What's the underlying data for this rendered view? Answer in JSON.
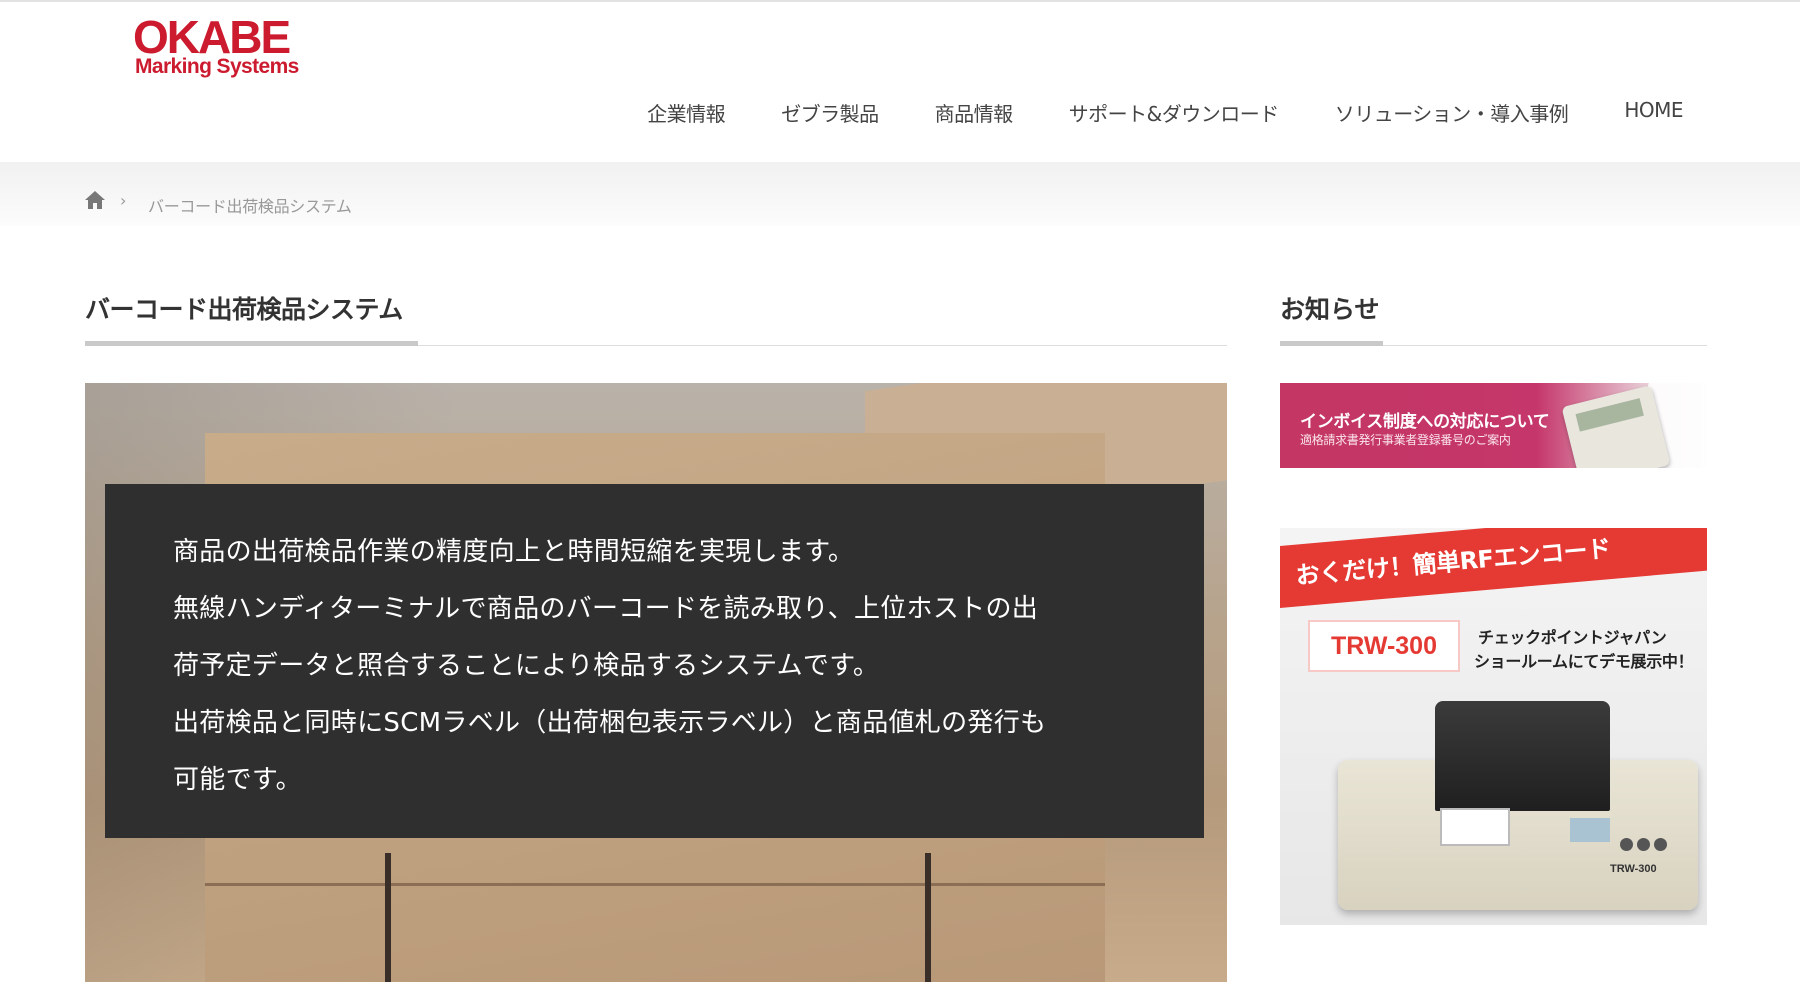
{
  "logo": {
    "word": "OKABE",
    "sub": "Marking Systems"
  },
  "nav": {
    "items": [
      {
        "label": "企業情報"
      },
      {
        "label": "ゼブラ製品"
      },
      {
        "label": "商品情報"
      },
      {
        "label": "サポート&ダウンロード"
      },
      {
        "label": "ソリューション・導入事例"
      },
      {
        "label": "HOME"
      }
    ]
  },
  "breadcrumb": {
    "separator": "›",
    "current": "バーコード出荷検品システム"
  },
  "main": {
    "title": "バーコード出荷検品システム",
    "description_lines": [
      "商品の出荷検品作業の精度向上と時間短縮を実現します。",
      "無線ハンディターミナルで商品のバーコードを読み取り、上位ホストの出",
      "荷予定データと照合することにより検品するシステムです。",
      "出荷検品と同時にSCMラベル（出荷梱包表示ラベル）と商品値札の発行も",
      "可能です。"
    ]
  },
  "sidebar": {
    "title": "お知らせ",
    "banner1": {
      "headline": "インボイス制度への対応について",
      "subline": "適格請求書発行事業者登録番号のご案内"
    },
    "banner2": {
      "ribbon": "おくだけ！簡単RFエンコード",
      "model": "TRW-300",
      "promo_line1": "チェックポイントジャパン",
      "promo_line2": "ショールームにてデモ展示中！",
      "device_label": "TRW-300"
    }
  },
  "colors": {
    "brand": "#cc1a2e",
    "overlay": "#2f2f2f",
    "ribbon": "#e53a33",
    "banner1": "#c43663"
  }
}
